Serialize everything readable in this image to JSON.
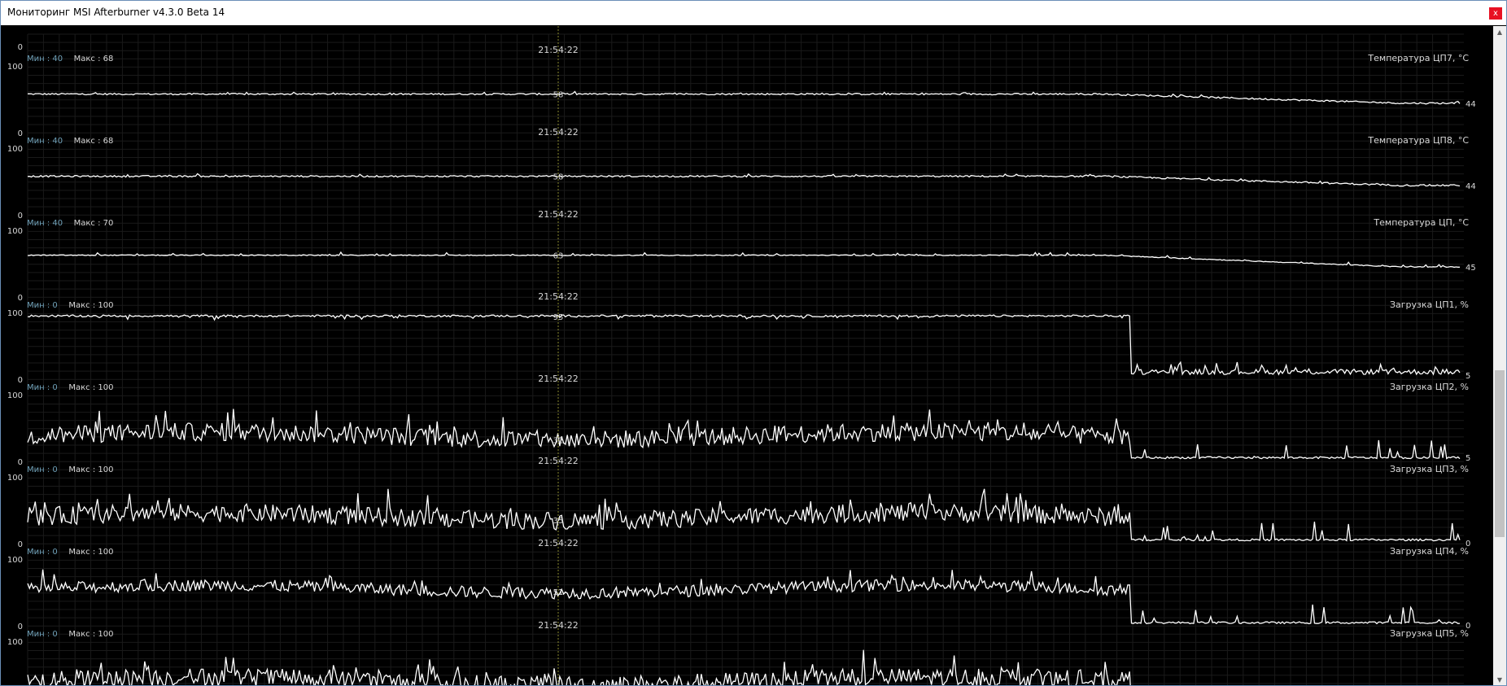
{
  "window": {
    "title": "Мониторинг MSI Afterburner v4.3.0 Beta 14",
    "close_label": "x"
  },
  "colors": {
    "background": "#000000",
    "grid": "#1a1a1a",
    "line": "#ffffff",
    "min_label": "#6fa0b8",
    "text": "#d8d8d8",
    "cursor": "#8a8a30"
  },
  "labels": {
    "min_prefix": "Мин : ",
    "max_prefix": "Макс : ",
    "timestamp": "21:54:22"
  },
  "graphs": [
    {
      "title": "Температура ЦП7, °С",
      "min": "40",
      "max": "68",
      "axis_top": "100",
      "axis_bottom": "0",
      "cursor_value": "58",
      "current_value": "44",
      "ymax": 100,
      "profile": {
        "mode": "stable",
        "start": 58,
        "end": 44,
        "drop_at": 0.75,
        "noise": 1.2,
        "spike_chance": 0.05,
        "spike": 3
      }
    },
    {
      "title": "Температура ЦП8, °С",
      "min": "40",
      "max": "68",
      "axis_top": "100",
      "axis_bottom": "0",
      "cursor_value": "58",
      "current_value": "44",
      "ymax": 100,
      "profile": {
        "mode": "stable",
        "start": 58,
        "end": 44,
        "drop_at": 0.75,
        "noise": 1.2,
        "spike_chance": 0.05,
        "spike": 3
      }
    },
    {
      "title": "Температура ЦП, °С",
      "min": "40",
      "max": "70",
      "axis_top": "100",
      "axis_bottom": "0",
      "cursor_value": "63",
      "current_value": "45",
      "ymax": 100,
      "profile": {
        "mode": "stable",
        "start": 63,
        "end": 45,
        "drop_at": 0.75,
        "noise": 0.6,
        "spike_chance": 0.06,
        "spike": 4
      }
    },
    {
      "title": "Загрузка ЦП1, %",
      "min": "0",
      "max": "100",
      "axis_top": "100",
      "axis_bottom": "0",
      "cursor_value": "95",
      "current_value": "5",
      "ymax": 100,
      "profile": {
        "mode": "load_high",
        "start": 96,
        "end": 6,
        "drop_at": 0.77,
        "noise": 1.5,
        "spike_chance": 0.08,
        "spike": -5
      }
    },
    {
      "title": "Загрузка ЦП2, %",
      "min": "0",
      "max": "100",
      "axis_top": "100",
      "axis_bottom": "0",
      "cursor_value": "32",
      "current_value": "5",
      "ymax": 100,
      "profile": {
        "mode": "load_noisy",
        "start": 38,
        "end": 3,
        "drop_at": 0.77,
        "noise": 14,
        "spike_chance": 0.1,
        "spike": 30
      }
    },
    {
      "title": "Загрузка ЦП3, %",
      "min": "0",
      "max": "100",
      "axis_top": "100",
      "axis_bottom": "0",
      "cursor_value": "35",
      "current_value": "0",
      "ymax": 100,
      "profile": {
        "mode": "load_noisy",
        "start": 40,
        "end": 3,
        "drop_at": 0.77,
        "noise": 14,
        "spike_chance": 0.1,
        "spike": 30
      }
    },
    {
      "title": "Загрузка ЦП4, %",
      "min": "0",
      "max": "100",
      "axis_top": "100",
      "axis_bottom": "0",
      "cursor_value": "51",
      "current_value": "0",
      "ymax": 100,
      "profile": {
        "mode": "load_noisy",
        "start": 55,
        "end": 2,
        "drop_at": 0.77,
        "noise": 9,
        "spike_chance": 0.08,
        "spike": 22
      }
    },
    {
      "title": "Загрузка ЦП5, %",
      "min": "0",
      "max": "100",
      "axis_top": "100",
      "axis_bottom": "",
      "cursor_value": "",
      "current_value": "",
      "ymax": 100,
      "profile": {
        "mode": "load_noisy",
        "start": 40,
        "end": 3,
        "drop_at": 0.77,
        "noise": 14,
        "spike_chance": 0.1,
        "spike": 30
      }
    }
  ]
}
